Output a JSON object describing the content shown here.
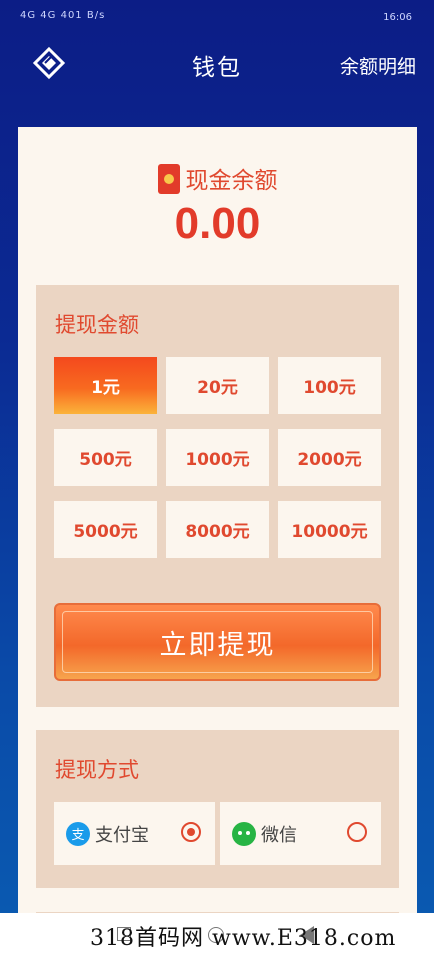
{
  "statusbar": {
    "left_text": "4G 4G 401 B/s",
    "time": "16:06"
  },
  "nav": {
    "title": "钱包",
    "detail_link": "余额明细"
  },
  "balance": {
    "label": "现金余额",
    "value": "0.00"
  },
  "withdraw_amount": {
    "title": "提现金额",
    "options": [
      "1元",
      "20元",
      "100元",
      "500元",
      "1000元",
      "2000元",
      "5000元",
      "8000元",
      "10000元"
    ],
    "selected": "1元"
  },
  "withdraw_button": "立即提现",
  "withdraw_method": {
    "title": "提现方式",
    "options": [
      {
        "label": "支付宝",
        "icon": "alipay-icon",
        "checked": true
      },
      {
        "label": "微信",
        "icon": "wechat-icon",
        "checked": false
      }
    ]
  },
  "watermark": "318首码网  www.E318.com",
  "colors": {
    "accent": "#e0492f",
    "background_top": "#0c1d86",
    "panel": "#ebd5c3",
    "card": "#fcf6ee"
  }
}
